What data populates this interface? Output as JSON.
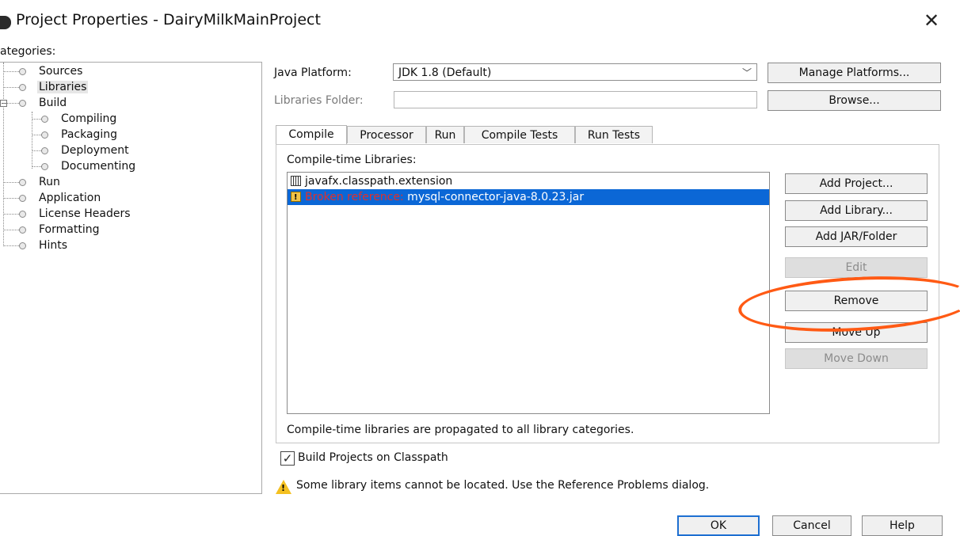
{
  "window": {
    "title": "Project Properties - DairyMilkMainProject",
    "close_glyph": "✕"
  },
  "categories": {
    "label": "ategories:",
    "items": [
      {
        "label": "Sources",
        "level": 0
      },
      {
        "label": "Libraries",
        "level": 0,
        "selected": true
      },
      {
        "label": "Build",
        "level": 0,
        "expandable": true
      },
      {
        "label": "Compiling",
        "level": 1
      },
      {
        "label": "Packaging",
        "level": 1
      },
      {
        "label": "Deployment",
        "level": 1
      },
      {
        "label": "Documenting",
        "level": 1
      },
      {
        "label": "Run",
        "level": 0
      },
      {
        "label": "Application",
        "level": 0
      },
      {
        "label": "License Headers",
        "level": 0
      },
      {
        "label": "Formatting",
        "level": 0
      },
      {
        "label": "Hints",
        "level": 0
      }
    ]
  },
  "platform": {
    "label": "Java Platform:",
    "value": "JDK 1.8 (Default)",
    "manage_button": "Manage Platforms..."
  },
  "libraries_folder": {
    "label": "Libraries Folder:",
    "value": "",
    "browse_button": "Browse..."
  },
  "tabs": [
    {
      "label": "Compile",
      "active": true
    },
    {
      "label": "Processor"
    },
    {
      "label": "Run"
    },
    {
      "label": "Compile Tests"
    },
    {
      "label": "Run Tests"
    }
  ],
  "compile": {
    "list_label": "Compile-time Libraries:",
    "items": [
      {
        "icon": "library-icon",
        "text": "javafx.classpath.extension"
      },
      {
        "icon": "broken-reference-icon",
        "prefix": "Broken reference:",
        "text": " mysql-connector-java-8.0.23.jar",
        "selected": true
      }
    ],
    "note": "Compile-time libraries are propagated to all library categories.",
    "buttons": {
      "add_project": "Add Project...",
      "add_library": "Add Library...",
      "add_jar": "Add JAR/Folder",
      "edit": "Edit",
      "remove": "Remove",
      "move_up": "Move Up",
      "move_down": "Move Down"
    }
  },
  "build_on_classpath": {
    "label": "Build Projects on Classpath",
    "checked": true,
    "check_glyph": "✓"
  },
  "warning": {
    "text": "Some library items cannot be located. Use the Reference Problems dialog."
  },
  "footer": {
    "ok": "OK",
    "cancel": "Cancel",
    "help": "Help"
  },
  "colors": {
    "accent": "#0b67d6",
    "broken": "#e2302a",
    "annotation": "#ff5a14"
  }
}
